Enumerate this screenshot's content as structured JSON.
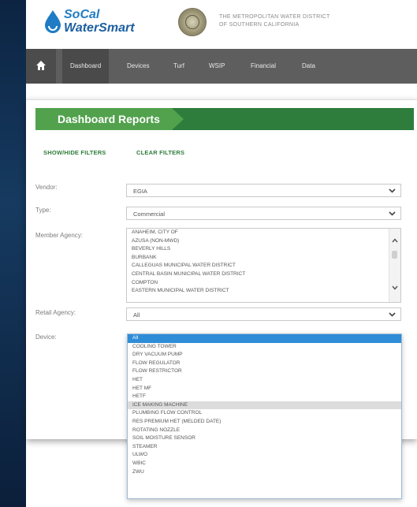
{
  "brand": {
    "line1": "SoCal",
    "line2": "WaterSmart"
  },
  "district": {
    "line1": "THE METROPOLITAN WATER DISTRICT",
    "line2": "OF SOUTHERN CALIFORNIA"
  },
  "nav": {
    "home_icon": "home-icon",
    "items": [
      {
        "label": "Dashboard",
        "active": true
      },
      {
        "label": "Devices",
        "active": false
      },
      {
        "label": "Turf",
        "active": false
      },
      {
        "label": "WSIP",
        "active": false
      },
      {
        "label": "Financial",
        "active": false
      },
      {
        "label": "Data",
        "active": false
      }
    ]
  },
  "panel": {
    "title": "Dashboard Reports",
    "show_hide_filters": "SHOW/HIDE FILTERS",
    "clear_filters": "CLEAR FILTERS"
  },
  "filters": {
    "vendor": {
      "label": "Vendor:",
      "value": "EGIA"
    },
    "type": {
      "label": "Type:",
      "value": "Commercial"
    },
    "member_agency": {
      "label": "Member Agency:",
      "options": [
        "ANAHEIM, CITY OF",
        "AZUSA (NON-MWD)",
        "BEVERLY HILLS",
        "BURBANK",
        "CALLEGUAS MUNICIPAL WATER DISTRICT",
        "CENTRAL BASIN MUNICIPAL WATER DISTRICT",
        "COMPTON",
        "EASTERN MUNICIPAL WATER DISTRICT"
      ]
    },
    "retail_agency": {
      "label": "Retail Agency:",
      "value": "All"
    },
    "device": {
      "label": "Device:",
      "selected": "All",
      "highlighted": "ICE MAKING MACHINE",
      "options": [
        "All",
        "COOLING TOWER",
        "DRY VACUUM PUMP",
        "FLOW REGULATOR",
        "FLOW RESTRICTOR",
        "HET",
        "HET MF",
        "HETF",
        "ICE MAKING MACHINE",
        "PLUMBING FLOW CONTROL",
        "RES PREMIUM HET (MELDED DATE)",
        "ROTATING NOZZLE",
        "SOIL MOISTURE SENSOR",
        "STEAMER",
        "ULWO",
        "WBIC",
        "ZWU"
      ]
    }
  },
  "colors": {
    "accent_green": "#2e7d3c",
    "tab_green": "#52a24d",
    "nav_gray": "#5e5e5e",
    "selection_blue": "#2f8dd8",
    "brand_blue": "#1f7cc4"
  }
}
